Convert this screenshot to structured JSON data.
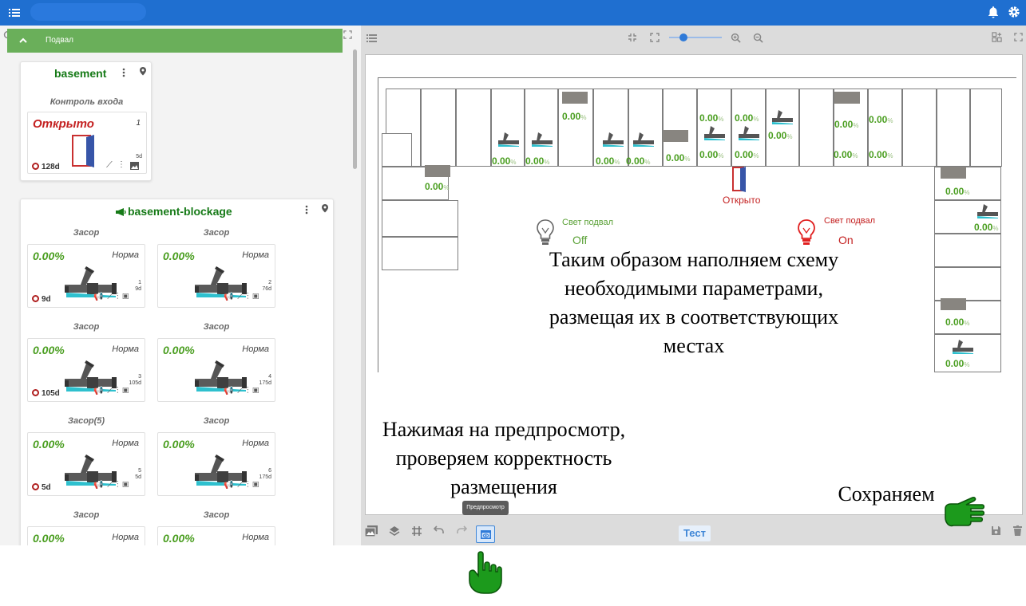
{
  "app": {
    "title": "",
    "accent": "#1f6fd0",
    "green": "#6aaf5a"
  },
  "group": {
    "label": "Подвал"
  },
  "basement": {
    "title": "basement",
    "widget_caption": "Контроль входа",
    "door_state": "Открыто",
    "door_index": "1",
    "door_age": "128d",
    "door_sub": "5d"
  },
  "blockage": {
    "title": "basement-blockage",
    "tiles": [
      {
        "caption": "Засор",
        "pct": "0.00%",
        "state": "Норма",
        "index": "1",
        "sub": "9d",
        "age": "9d"
      },
      {
        "caption": "Засор",
        "pct": "0.00%",
        "state": "Норма",
        "index": "2",
        "sub": "76d",
        "age": ""
      },
      {
        "caption": "Засор",
        "pct": "0.00%",
        "state": "Норма",
        "index": "3",
        "sub": "105d",
        "age": "105d"
      },
      {
        "caption": "Засор",
        "pct": "0.00%",
        "state": "Норма",
        "index": "4",
        "sub": "175d",
        "age": ""
      },
      {
        "caption": "Засор(5)",
        "pct": "0.00%",
        "state": "Норма",
        "index": "5",
        "sub": "5d",
        "age": "5d"
      },
      {
        "caption": "Засор",
        "pct": "0.00%",
        "state": "Норма",
        "index": "6",
        "sub": "175d",
        "age": ""
      },
      {
        "caption": "Засор",
        "pct": "0.00%",
        "state": "Норма",
        "index": "",
        "sub": "",
        "age": ""
      },
      {
        "caption": "Засор",
        "pct": "0.00%",
        "state": "Норма",
        "index": "",
        "sub": "",
        "age": ""
      }
    ]
  },
  "plan": {
    "values": [
      "0.00",
      "0.00",
      "0.00",
      "0.00",
      "0.00",
      "0.00",
      "0.00",
      "0.00",
      "0.00",
      "0.00",
      "0.00",
      "0.00",
      "0.00",
      "0.00",
      "0.00",
      "0.00",
      "0.00",
      "0.00",
      "0.00",
      "0.00"
    ],
    "unit": "%",
    "door_state": "Открыто",
    "lamp1": {
      "label": "Свет подвал",
      "state": "Off"
    },
    "lamp2": {
      "label": "Свет подвал",
      "state": "On"
    }
  },
  "annotations": {
    "main": [
      "Таким образом наполняем схему",
      "необходимыми параметрами,",
      "размещая их в соответствующих",
      "местах"
    ],
    "preview": [
      "Нажимая на предпросмотр,",
      "проверяем корректность",
      "размещения"
    ],
    "save": "Сохраняем"
  },
  "toolbar": {
    "test_label": "Тест",
    "preview_tooltip": "Предпросмотр"
  }
}
